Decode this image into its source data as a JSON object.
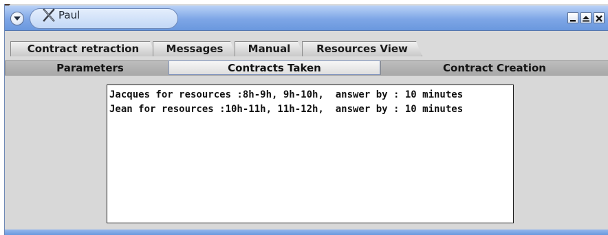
{
  "window": {
    "title": "Paul",
    "title_icon": "x-window-icon",
    "controls": [
      "minimize-icon",
      "maximize-icon",
      "close-icon"
    ],
    "accent_color": "#7ea6e6"
  },
  "tabs_top": [
    {
      "label": "Contract retraction"
    },
    {
      "label": "Messages"
    },
    {
      "label": "Manual"
    },
    {
      "label": "Resources View"
    }
  ],
  "tabs_bottom": [
    {
      "label": "Parameters",
      "selected": false
    },
    {
      "label": "Contracts Taken",
      "selected": true
    },
    {
      "label": "Contract Creation",
      "selected": false
    }
  ],
  "contracts": [
    {
      "text": "Jacques for resources :8h-9h, 9h-10h,  answer by : 10 minutes"
    },
    {
      "text": "Jean for resources :10h-11h, 11h-12h,  answer by : 10 minutes"
    }
  ]
}
